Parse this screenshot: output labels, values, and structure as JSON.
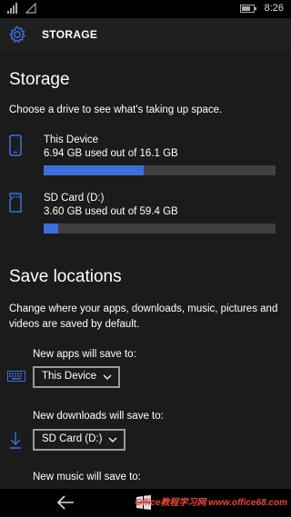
{
  "status": {
    "time": "8:26"
  },
  "header": {
    "title": "STORAGE"
  },
  "storage": {
    "title": "Storage",
    "description": "Choose a drive to see what's taking up space.",
    "drives": [
      {
        "name": "This Device",
        "usage": "6.94 GB used out of 16.1 GB",
        "used_fraction": 0.431
      },
      {
        "name": "SD Card (D:)",
        "usage": "3.60 GB used out of 59.4 GB",
        "used_fraction": 0.061
      }
    ]
  },
  "save_locations": {
    "title": "Save locations",
    "description": "Change where your apps, downloads, music, pictures and videos are saved by default.",
    "apps": {
      "label": "New apps will save to:",
      "value": "This Device"
    },
    "downloads": {
      "label": "New downloads will save to:",
      "value": "SD Card (D:)"
    },
    "music": {
      "label": "New music will save to:"
    }
  },
  "watermark": "Office教程学习网 www.office68.com",
  "colors": {
    "accent": "#3a6fdd",
    "bar_track": "#404040",
    "background": "#1b1b1b",
    "header": "#1f1f1f"
  }
}
